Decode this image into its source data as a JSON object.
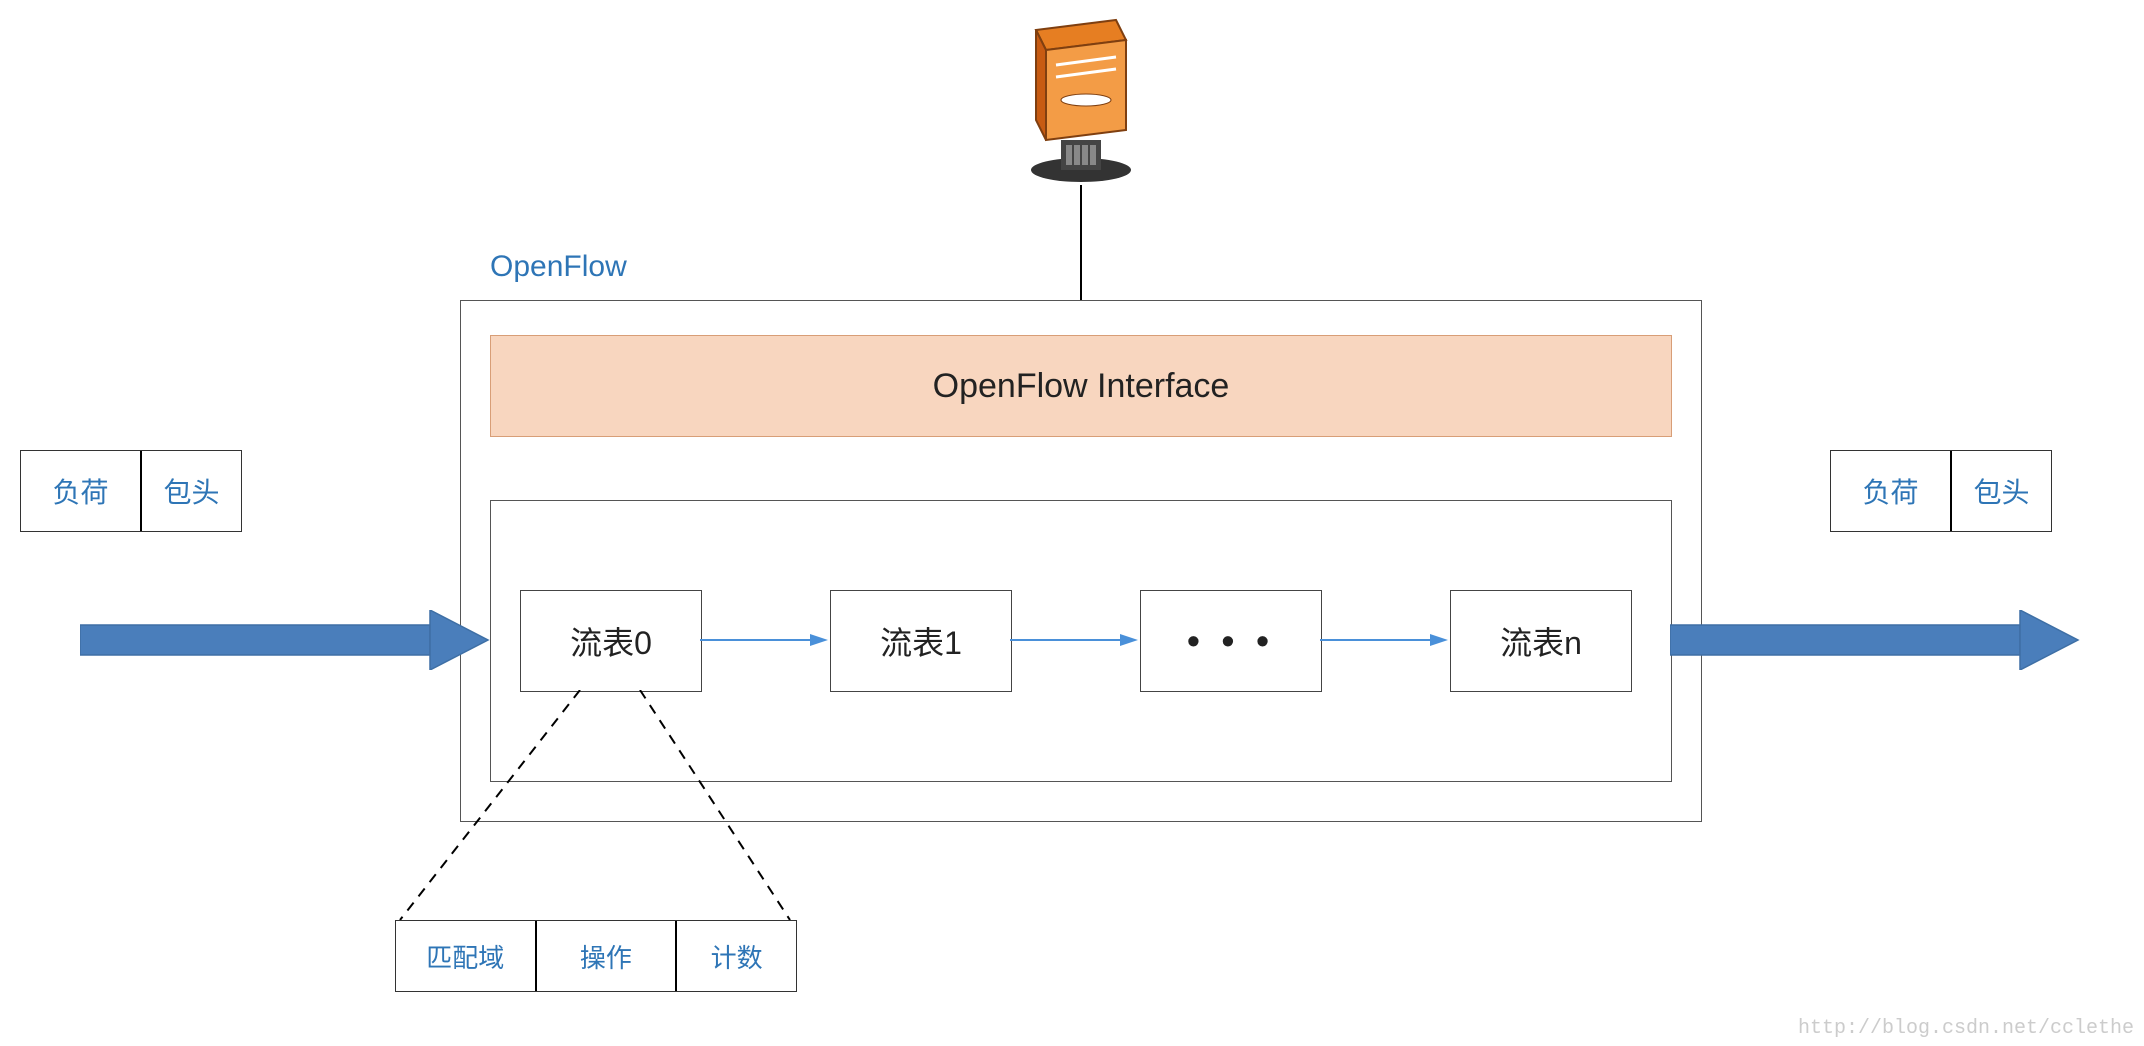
{
  "labels": {
    "openflow": "OpenFlow",
    "interface": "OpenFlow Interface",
    "flow0": "流表0",
    "flow1": "流表1",
    "flowdots": "•   •   •",
    "flown": "流表n",
    "payload_left": "负荷",
    "header_left": "包头",
    "payload_right": "负荷",
    "header_right": "包头",
    "match": "匹配域",
    "action": "操作",
    "count": "计数",
    "watermark": "http://blog.csdn.net/cclethe"
  },
  "colors": {
    "blue": "#2E75B6",
    "arrowBlue": "#3E7CB1",
    "arrowBlueFill": "#4A7EBB",
    "peach": "#F8D6BF",
    "peachBorder": "#D89E77",
    "server1": "#E67E22",
    "server2": "#D35400",
    "black": "#222"
  }
}
